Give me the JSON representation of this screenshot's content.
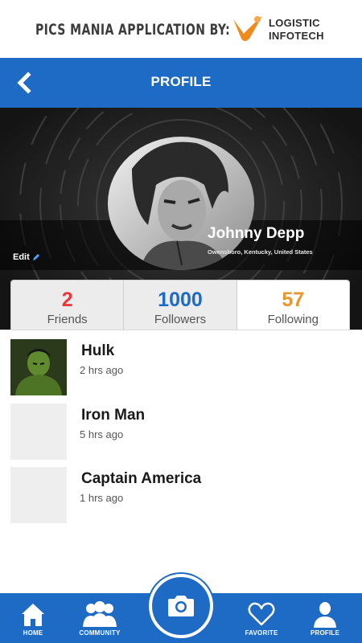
{
  "branding": {
    "tagline": "PICS MANIA APPLICATION BY:",
    "logo_line1": "LOGISTIC",
    "logo_line2": "INFOTECH"
  },
  "header": {
    "title": "PROFILE",
    "back_icon": "chevron-left-icon"
  },
  "profile": {
    "name": "Johnny Depp",
    "location": "Owensboro, Kentucky, United States",
    "edit_label": "Edit",
    "edit_icon": "pencil-icon"
  },
  "stats": [
    {
      "value": "2",
      "label": "Friends",
      "color": "#e8383d"
    },
    {
      "value": "1000",
      "label": "Followers",
      "color": "#1e6bc6"
    },
    {
      "value": "57",
      "label": "Following",
      "color": "#e9962a"
    }
  ],
  "list": [
    {
      "name": "Hulk",
      "time": "2 hrs ago"
    },
    {
      "name": "Iron Man",
      "time": "5 hrs ago"
    },
    {
      "name": "Captain America",
      "time": "1 hrs ago"
    }
  ],
  "bottom_nav": [
    {
      "label": "HOME",
      "icon": "home-icon"
    },
    {
      "label": "COMMUNITY",
      "icon": "community-icon"
    },
    {
      "label": "",
      "icon": "camera-icon"
    },
    {
      "label": "FAVORITE",
      "icon": "heart-icon"
    },
    {
      "label": "PROFILE",
      "icon": "profile-icon"
    }
  ],
  "colors": {
    "primary": "#1e6bc6",
    "friends": "#e8383d",
    "followers": "#1e6bc6",
    "following": "#e9962a",
    "logo_accent": "#f08a1c"
  }
}
